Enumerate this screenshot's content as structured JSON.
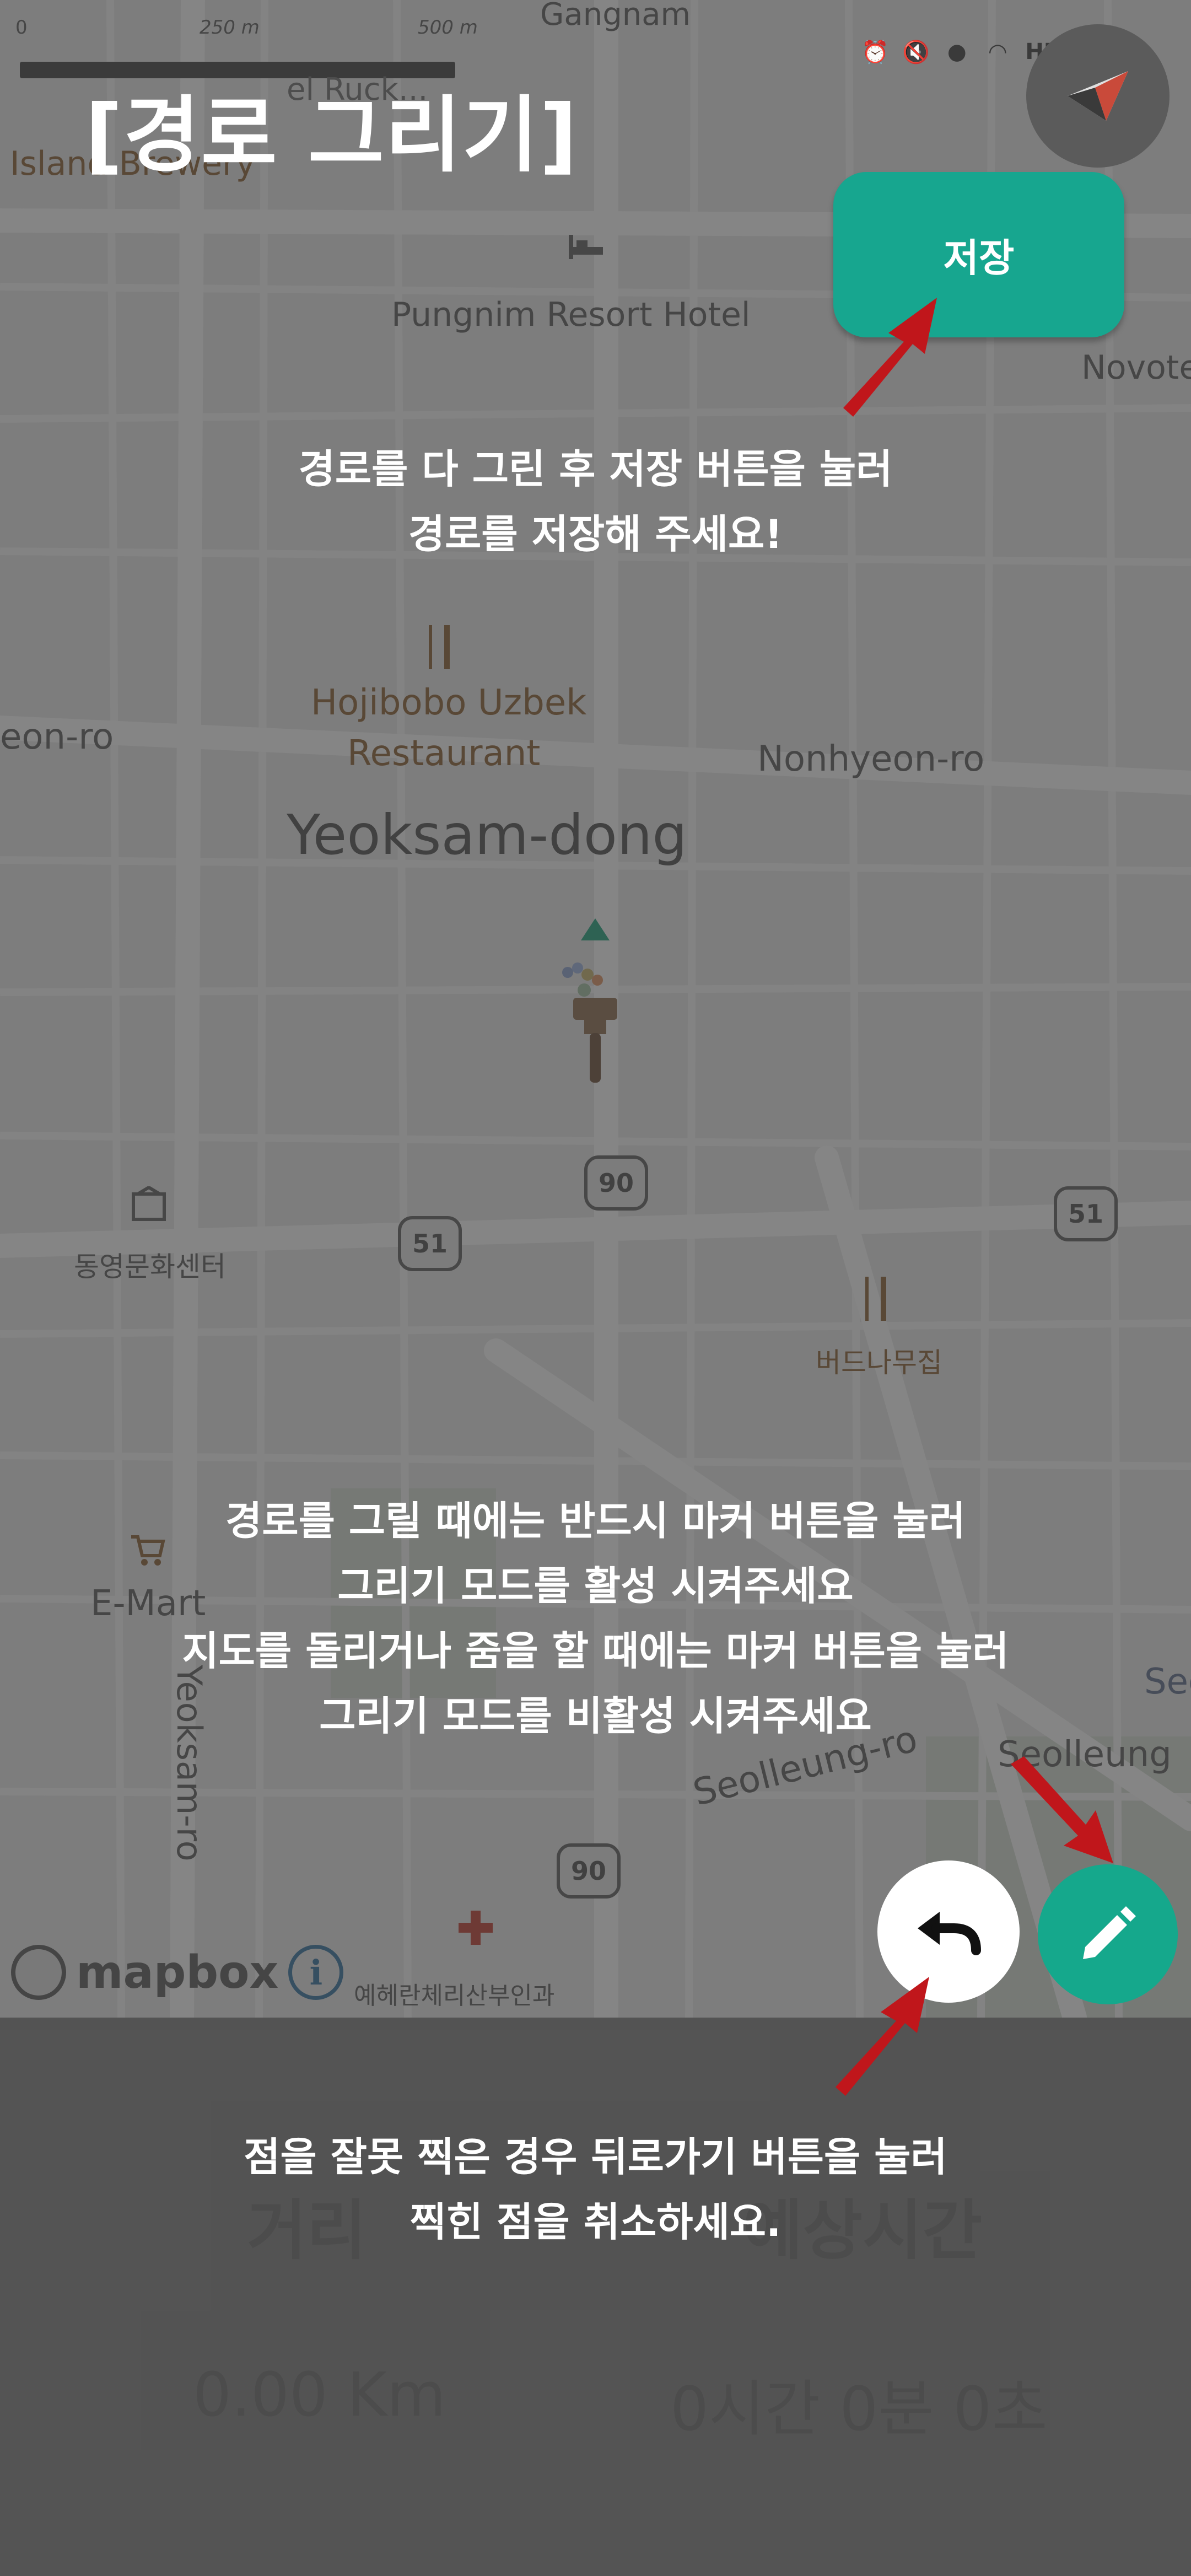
{
  "title": "[경로 그리기]",
  "save_button": {
    "label": "저장"
  },
  "captions": {
    "save_hint": [
      "경로를 다 그린 후 저장 버튼을 눌러",
      "경로를 저장해 주세요!"
    ],
    "draw_hint": [
      "경로를 그릴 때에는 반드시 마커 버튼을 눌러",
      "그리기 모드를 활성 시켜주세요",
      "지도를 돌리거나 줌을 할 때에는 마커 버튼을 눌러",
      "그리기 모드를 비활성 시켜주세요"
    ],
    "undo_hint": [
      "점을 잘못 찍은 경우 뒤로가기 버튼을 눌러",
      "찍힌 점을 취소하세요."
    ]
  },
  "status_bar": {
    "network": "HD",
    "voice": "Voice"
  },
  "map": {
    "scale": {
      "zero": "0",
      "a": "250 m",
      "b": "500 m"
    },
    "labels": {
      "gangnam": "Gangnam",
      "hotel_top": "el Ruck...",
      "island": "Island Brewery",
      "pungnim": "Pungnim Resort Hotel",
      "novotel": "Novotel",
      "eon_ro": "eon-ro",
      "hojibobo1": "Hojibobo Uzbek",
      "hojibobo2": "Restaurant",
      "nonhyeon": "Nonhyeon-ro",
      "yeoksam_dong": "Yeoksam-dong",
      "community": "동영문화센터",
      "tree": "버드나무집",
      "emart": "E-Mart",
      "yeoksam_ro": "Yeoksam-ro",
      "seolleung_ro": "Seolleung-ro",
      "seolleung": "Seolleung",
      "seo": "Seo",
      "clinic": "예헤란체리산부인과",
      "mapbox": "mapbox",
      "info": "i"
    },
    "shields": {
      "s90a": "90",
      "s51a": "51",
      "s51b": "51",
      "s90b": "90"
    }
  },
  "stats": {
    "distance_label": "거리",
    "time_label": "예상시간",
    "distance_value": "0.00 Km",
    "time_value": "0시간 0분 0초"
  },
  "colors": {
    "accent": "#17a68f",
    "arrow": "#c0161b",
    "overlay_text": "#ffffff"
  }
}
